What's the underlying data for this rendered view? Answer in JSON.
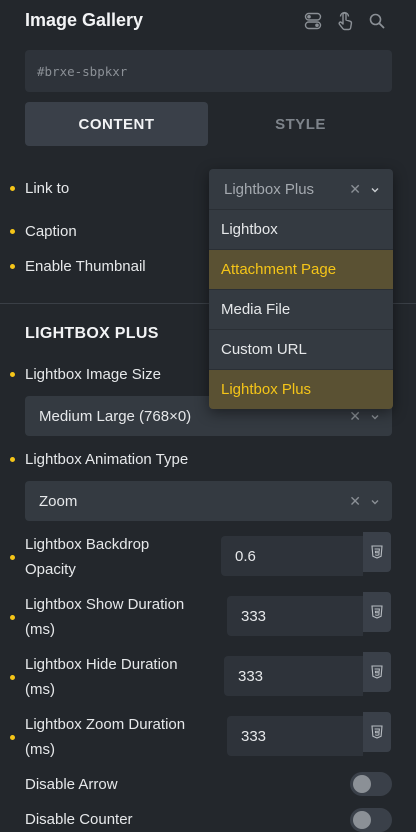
{
  "panel": {
    "title": "Image Gallery",
    "element_id": "#brxe-sbpkxr"
  },
  "tabs": [
    {
      "label": "CONTENT",
      "active": true
    },
    {
      "label": "STYLE",
      "active": false
    }
  ],
  "controls": {
    "link_to": {
      "label": "Link to",
      "value": "Lightbox Plus",
      "options": [
        "Lightbox",
        "Attachment Page",
        "Media File",
        "Custom URL",
        "Lightbox Plus"
      ],
      "highlighted": [
        "Attachment Page",
        "Lightbox Plus"
      ]
    },
    "caption": {
      "label": "Caption"
    },
    "enable_thumbnail": {
      "label": "Enable Thumbnail"
    }
  },
  "lightbox_plus": {
    "section_title": "LIGHTBOX PLUS",
    "image_size": {
      "label": "Lightbox Image Size",
      "value": "Medium Large (768×0)"
    },
    "animation_type": {
      "label": "Lightbox Animation Type",
      "value": "Zoom"
    },
    "backdrop_opacity": {
      "label_line1": "Lightbox Backdrop",
      "label_line2": "Opacity",
      "value": "0.6"
    },
    "show_duration": {
      "label_line1": "Lightbox Show Duration",
      "label_line2": "(ms)",
      "value": "333"
    },
    "hide_duration": {
      "label_line1": "Lightbox Hide Duration",
      "label_line2": "(ms)",
      "value": "333"
    },
    "zoom_duration": {
      "label_line1": "Lightbox Zoom Duration",
      "label_line2": "(ms)",
      "value": "333"
    },
    "disable_arrow": {
      "label": "Disable Arrow",
      "enabled": false
    },
    "disable_counter": {
      "label": "Disable Counter",
      "enabled": false
    }
  },
  "icons": [
    "toggle-icon",
    "hand-pointer-icon",
    "search-icon",
    "clear-icon",
    "chevron-down-icon",
    "css3-icon"
  ],
  "colors": {
    "background": "#23272c",
    "accent": "#f5c518",
    "highlight_bg": "#5a5133",
    "input_bg": "#2e333a",
    "select_bg": "#343a41"
  }
}
